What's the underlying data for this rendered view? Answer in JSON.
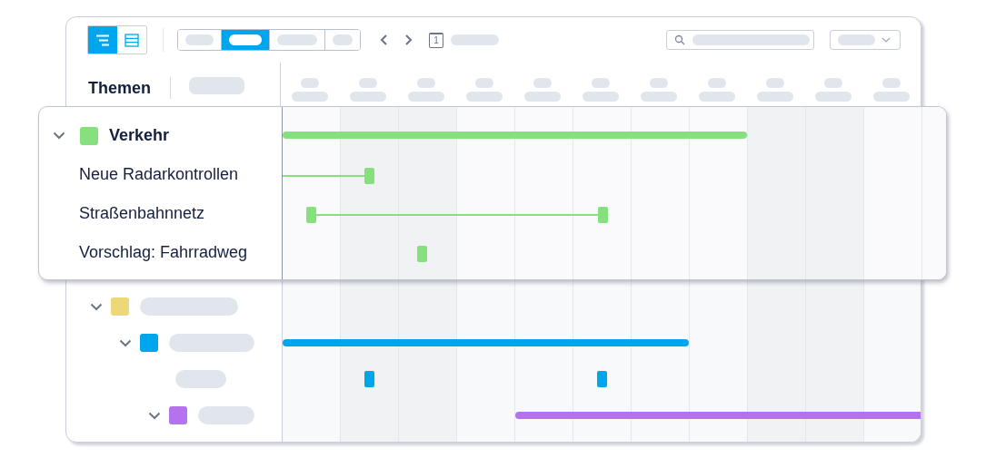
{
  "toolbar": {
    "views": [
      {
        "kind": "gantt",
        "selected": true
      },
      {
        "kind": "list",
        "selected": false
      }
    ],
    "range_segments": [
      {
        "selected": false
      },
      {
        "selected": true
      },
      {
        "selected": false
      },
      {
        "selected": false
      }
    ],
    "calendar_day": "1"
  },
  "sidebar_header": {
    "title": "Themen"
  },
  "timeline": {
    "columns": [
      {
        "shaded": false
      },
      {
        "shaded": true
      },
      {
        "shaded": true
      },
      {
        "shaded": false
      },
      {
        "shaded": false
      },
      {
        "shaded": false
      },
      {
        "shaded": false
      },
      {
        "shaded": false
      },
      {
        "shaded": true
      },
      {
        "shaded": true
      },
      {
        "shaded": false
      }
    ]
  },
  "focus_card": {
    "name": "Verkehr",
    "color": "#86e07e",
    "expanded": true,
    "children": [
      {
        "name": "Neue Radarkontrollen"
      },
      {
        "name": "Straßenbahnnetz"
      },
      {
        "name": "Vorschlag: Fahrradweg"
      }
    ]
  },
  "topics": [
    {
      "color": "#ecd878",
      "expanded": true,
      "children": [
        {
          "color": "#00a6ed",
          "expanded": true,
          "children": [
            {
              "kind": "item"
            },
            {
              "color": "#b472ee",
              "expanded": true
            }
          ]
        }
      ]
    }
  ]
}
